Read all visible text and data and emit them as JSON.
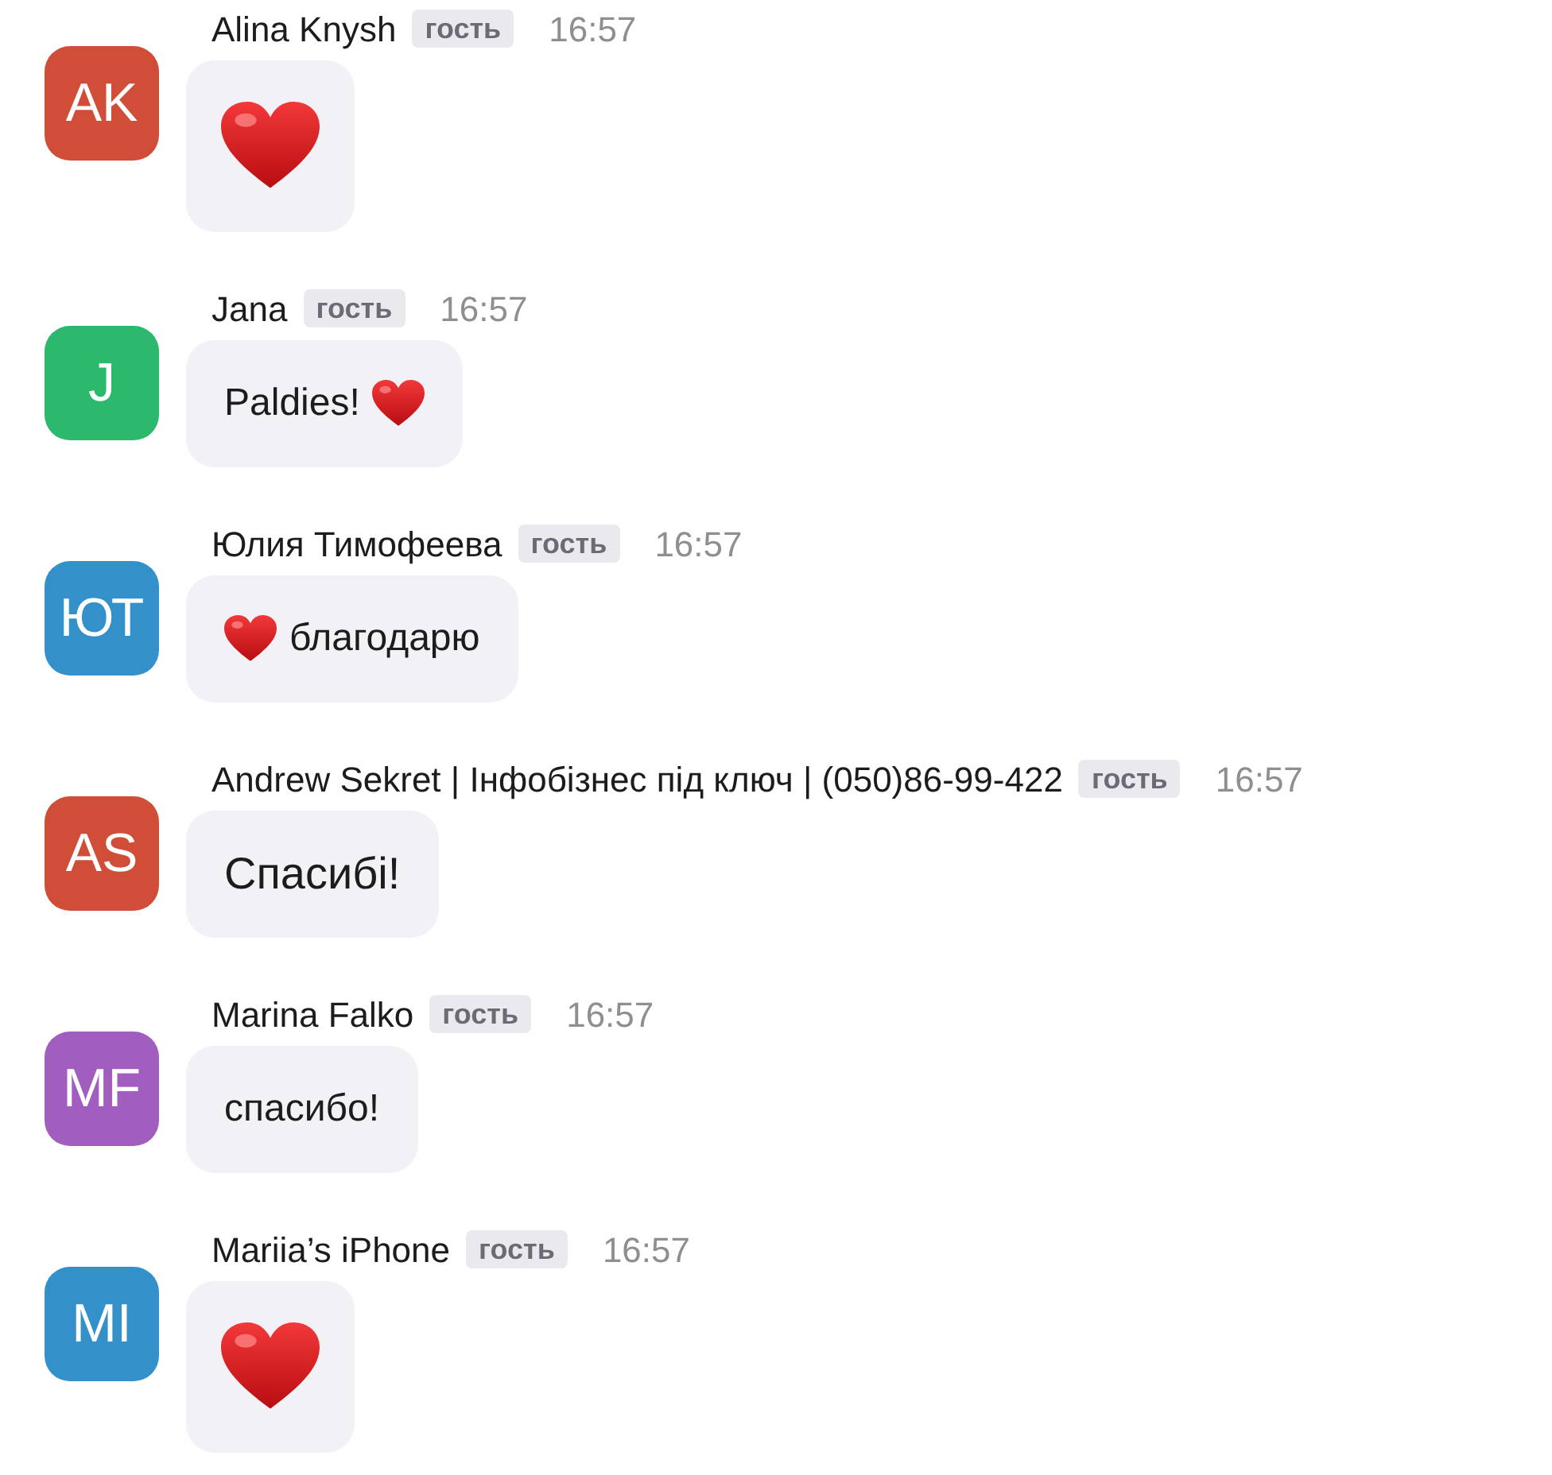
{
  "messages": [
    {
      "author": "Alina Knysh",
      "initials": "AK",
      "color": "#d04e37",
      "badge": "гость",
      "time": "16:57",
      "parts": [
        {
          "kind": "big-heart"
        }
      ]
    },
    {
      "author": "Jana",
      "initials": "J",
      "color": "#2cb86d",
      "badge": "гость",
      "time": "16:57",
      "parts": [
        {
          "kind": "text",
          "text": "Paldies!"
        },
        {
          "kind": "heart"
        }
      ]
    },
    {
      "author": "Юлия Тимофеева",
      "initials": "ЮТ",
      "color": "#3490c9",
      "badge": "гость",
      "time": "16:57",
      "parts": [
        {
          "kind": "heart"
        },
        {
          "kind": "text",
          "text": "благодарю"
        }
      ]
    },
    {
      "author": "Andrew Sekret | Інфобізнес під ключ | (050)86-99-422",
      "initials": "AS",
      "color": "#d04e37",
      "badge": "гость",
      "time": "16:57",
      "parts": [
        {
          "kind": "big-text",
          "text": "Спасибі!"
        }
      ]
    },
    {
      "author": "Marina Falko",
      "initials": "MF",
      "color": "#a25ebf",
      "badge": "гость",
      "time": "16:57",
      "parts": [
        {
          "kind": "text",
          "text": "спасибо!"
        }
      ]
    },
    {
      "author": "Mariia’s iPhone",
      "initials": "MI",
      "color": "#3490c9",
      "badge": "гость",
      "time": "16:57",
      "parts": [
        {
          "kind": "big-heart"
        }
      ]
    }
  ]
}
